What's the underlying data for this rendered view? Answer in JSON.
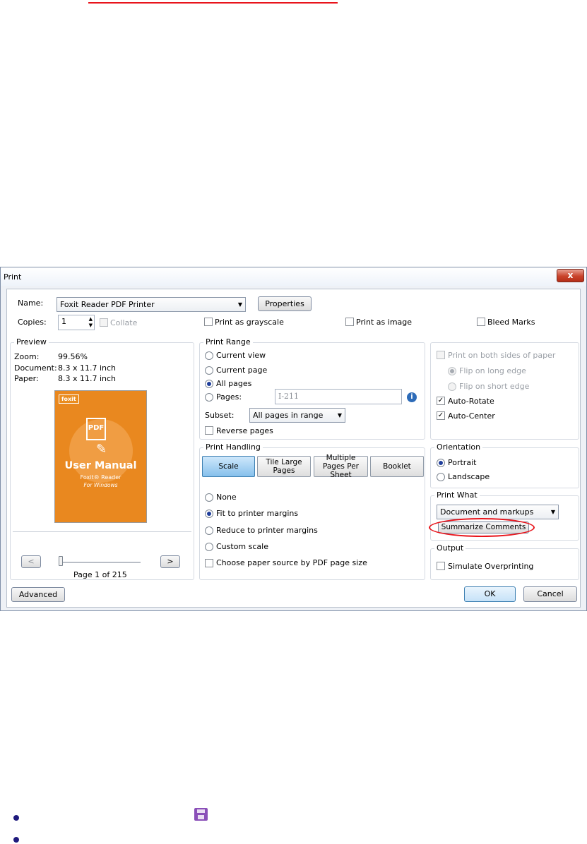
{
  "dialog": {
    "title": "Print",
    "close_glyph": "x"
  },
  "printer": {
    "name_label": "Name:",
    "name_value": "Foxit Reader PDF Printer",
    "properties_label": "Properties"
  },
  "copies": {
    "label": "Copies:",
    "value": "1",
    "collate_label": "Collate"
  },
  "options": {
    "grayscale_label": "Print as grayscale",
    "image_label": "Print as image",
    "bleed_label": "Bleed Marks"
  },
  "preview": {
    "title": "Preview",
    "zoom_label": "Zoom:",
    "zoom_value": "99.56%",
    "document_label": "Document:",
    "document_value": "8.3 x 11.7 inch",
    "paper_label": "Paper:",
    "paper_value": "8.3 x 11.7 inch",
    "thumb": {
      "logo": "foxit",
      "doc": "PDF",
      "title": "User Manual",
      "sub1": "Foxit® Reader",
      "sub2": "For Windows"
    },
    "prev_label": "<",
    "next_label": ">",
    "page_status": "Page 1 of 215",
    "slider_value": 1
  },
  "print_range": {
    "title": "Print Range",
    "current_view": "Current view",
    "current_page": "Current page",
    "all_pages": "All pages",
    "pages_label": "Pages:",
    "pages_value": "I-211",
    "subset_label": "Subset:",
    "subset_value": "All pages in range",
    "reverse_label": "Reverse pages",
    "info_glyph": "i"
  },
  "duplex": {
    "both_sides": "Print on both sides of paper",
    "flip_long": "Flip on long edge",
    "flip_short": "Flip on short edge",
    "auto_rotate": "Auto-Rotate",
    "auto_center": "Auto-Center"
  },
  "handling": {
    "title": "Print Handling",
    "tabs": [
      {
        "label": "Scale"
      },
      {
        "label": "Tile Large Pages"
      },
      {
        "label": "Multiple Pages Per Sheet"
      },
      {
        "label": "Booklet"
      }
    ],
    "none": "None",
    "fit": "Fit to printer margins",
    "reduce": "Reduce to printer margins",
    "custom": "Custom scale",
    "paper_source": "Choose paper source by PDF page size"
  },
  "orientation": {
    "title": "Orientation",
    "portrait": "Portrait",
    "landscape": "Landscape"
  },
  "print_what": {
    "title": "Print What",
    "value": "Document and markups",
    "summarize_label": "Summarize Comments"
  },
  "output": {
    "title": "Output",
    "simulate_label": "Simulate Overprinting"
  },
  "footer": {
    "advanced_label": "Advanced",
    "ok_label": "OK",
    "cancel_label": "Cancel"
  },
  "colors": {
    "accent_red": "#e8141b",
    "active_tab": "#86c0ec",
    "bullet": "#1f1a7d",
    "save_icon": "#8a4fb8"
  }
}
